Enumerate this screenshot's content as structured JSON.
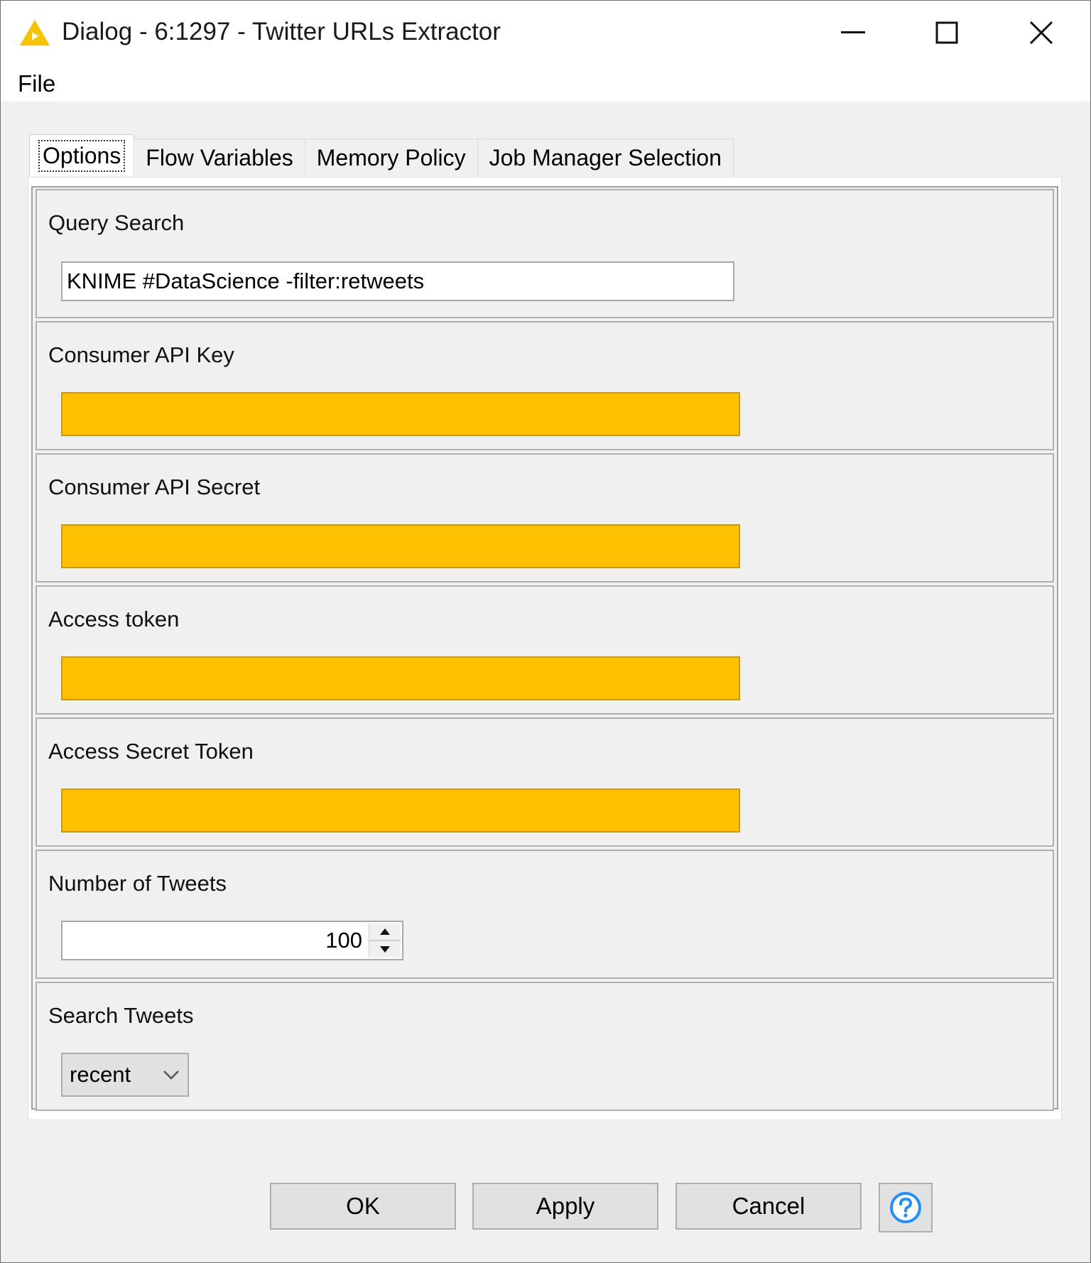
{
  "window": {
    "title": "Dialog - 6:1297 - Twitter URLs Extractor",
    "icon": "knime-node-warning-triangle-icon",
    "controls": [
      "minimize-icon",
      "maximize-icon",
      "close-icon"
    ]
  },
  "menu": {
    "items": [
      {
        "label": "File"
      }
    ]
  },
  "tabs": [
    {
      "label": "Options",
      "active": true
    },
    {
      "label": "Flow Variables",
      "active": false
    },
    {
      "label": "Memory Policy",
      "active": false
    },
    {
      "label": "Job Manager Selection",
      "active": false
    }
  ],
  "options": {
    "query_search": {
      "label": "Query Search",
      "value": "KNIME #DataScience -filter:retweets"
    },
    "consumer_api_key": {
      "label": "Consumer API Key",
      "value": "",
      "redacted": true
    },
    "consumer_api_secret": {
      "label": "Consumer API Secret",
      "value": "",
      "redacted": true
    },
    "access_token": {
      "label": "Access token",
      "value": "",
      "redacted": true
    },
    "access_secret_token": {
      "label": "Access Secret Token",
      "value": "",
      "redacted": true
    },
    "number_of_tweets": {
      "label": "Number of Tweets",
      "value": "100"
    },
    "search_tweets": {
      "label": "Search Tweets",
      "selected": "recent"
    }
  },
  "buttons": {
    "ok": "OK",
    "apply": "Apply",
    "cancel": "Cancel",
    "help": "help-icon"
  },
  "colors": {
    "redaction": "#ffc000",
    "accent_help": "#1e90ff",
    "warning_icon": "#f5c400"
  }
}
